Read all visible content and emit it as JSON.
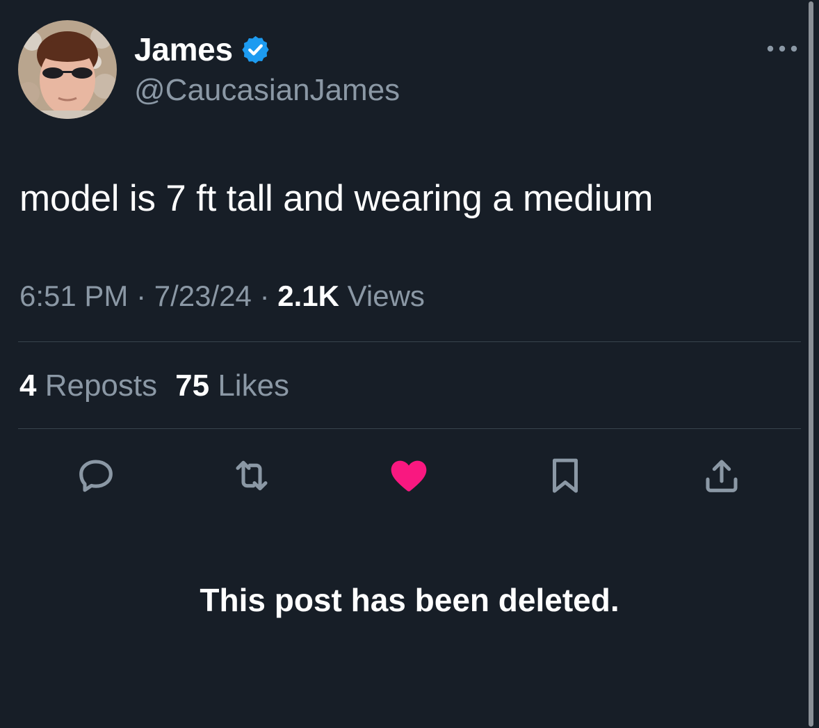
{
  "author": {
    "display_name": "James",
    "handle": "@CaucasianJames",
    "verified": true
  },
  "post": {
    "text": "model is 7 ft tall and wearing a medium",
    "time": "6:51 PM",
    "date": "7/23/24",
    "separator": "·",
    "views_count": "2.1K",
    "views_label": "Views"
  },
  "engagement": {
    "reposts_count": "4",
    "reposts_label": "Reposts",
    "likes_count": "75",
    "likes_label": "Likes"
  },
  "actions": [
    {
      "icon": "reply-icon"
    },
    {
      "icon": "repost-icon"
    },
    {
      "icon": "like-icon",
      "active": true
    },
    {
      "icon": "bookmark-icon"
    },
    {
      "icon": "share-icon"
    }
  ],
  "notice": {
    "deleted_text": "This post has been deleted."
  },
  "colors": {
    "background": "#171e27",
    "text": "#ffffff",
    "muted": "#8b98a5",
    "verified_badge": "#1d9bf0",
    "like_active": "#f91880",
    "divider": "#38444d"
  }
}
